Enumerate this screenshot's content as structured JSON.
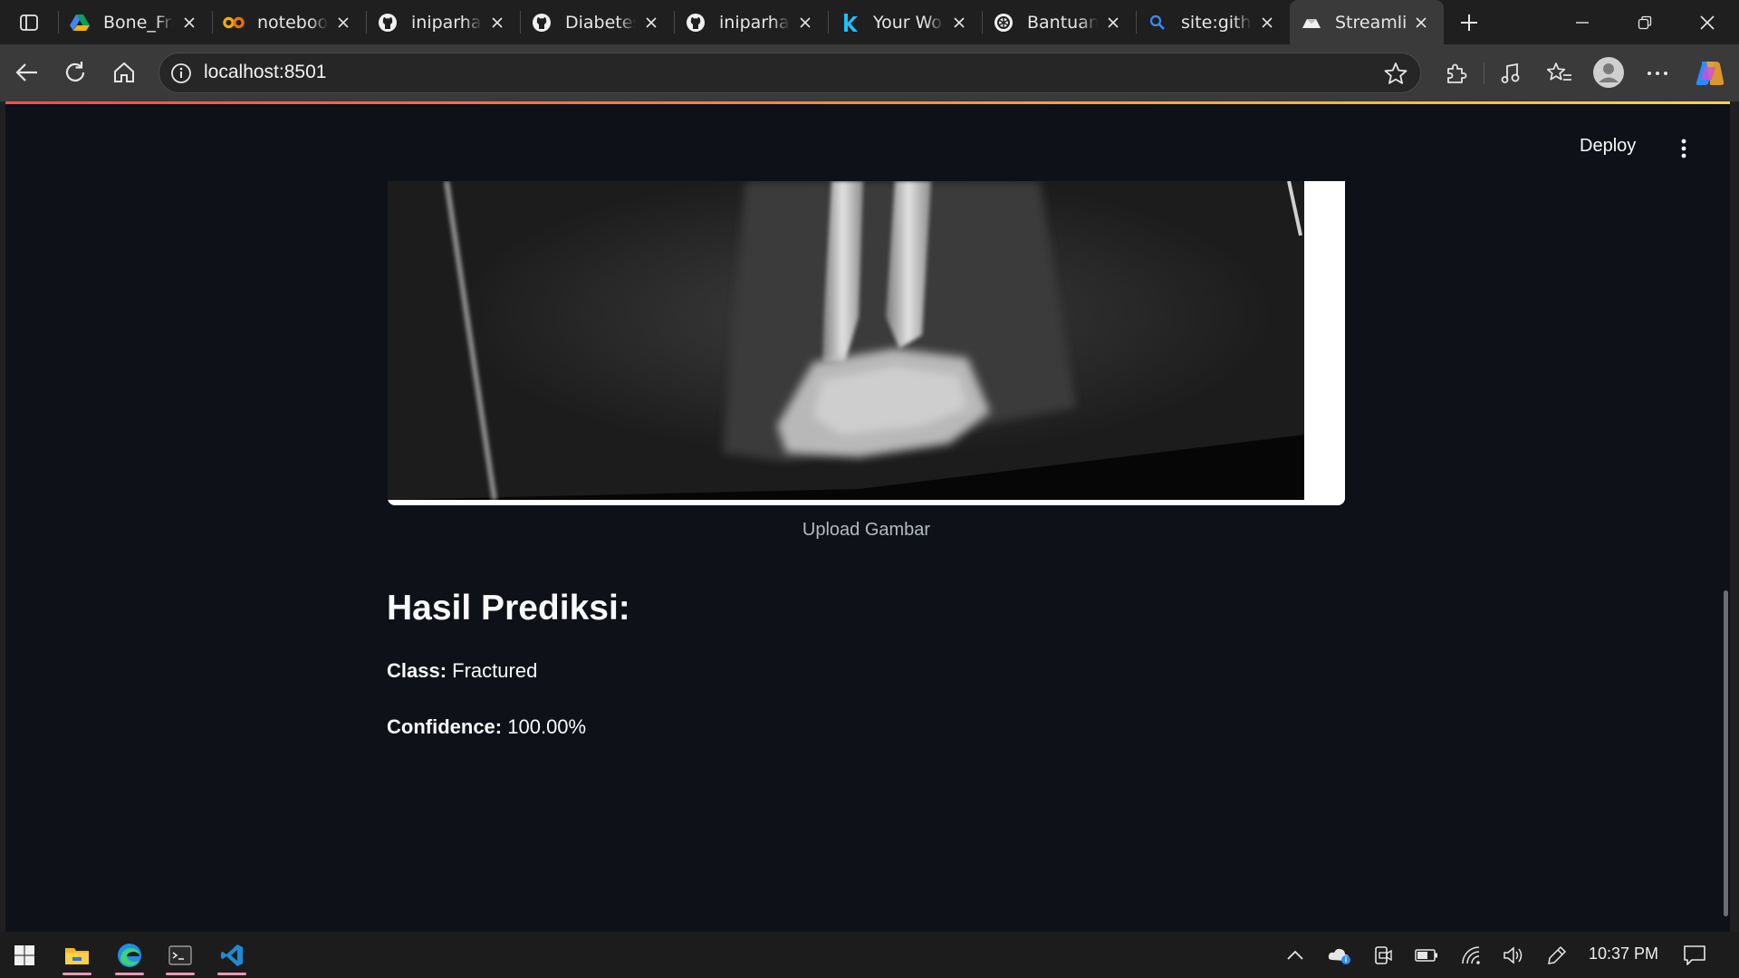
{
  "browser": {
    "tabs": [
      {
        "title": "Bone_Frac",
        "icon": "google-drive-icon",
        "active": false
      },
      {
        "title": "notebook",
        "icon": "colab-icon",
        "active": false
      },
      {
        "title": "iniparhan",
        "icon": "github-icon",
        "active": false
      },
      {
        "title": "Diabetes_",
        "icon": "github-icon",
        "active": false
      },
      {
        "title": "iniparhan",
        "icon": "github-icon",
        "active": false
      },
      {
        "title": "Your Worl",
        "icon": "kaggle-icon",
        "active": false
      },
      {
        "title": "Bantuan K",
        "icon": "chatgpt-icon",
        "active": false
      },
      {
        "title": "site:githul",
        "icon": "search-icon",
        "active": false
      },
      {
        "title": "Streamlit",
        "icon": "streamlit-icon",
        "active": true
      }
    ],
    "address": "localhost:8501"
  },
  "app": {
    "deploy_label": "Deploy",
    "image_caption": "Upload Gambar",
    "result_heading": "Hasil Prediksi:",
    "class_label": "Class:",
    "class_value": "Fractured",
    "confidence_label": "Confidence:",
    "confidence_value": "100.00%"
  },
  "taskbar": {
    "apps": [
      "windows-start-icon",
      "file-explorer-icon",
      "edge-icon",
      "terminal-icon",
      "vscode-icon"
    ],
    "time": "10:37 PM"
  },
  "colors": {
    "page_bg": "#0e1117",
    "accent_red": "#ff4b4b",
    "tab_bar": "#1f1f1f",
    "toolbar": "#3a3a3a"
  }
}
